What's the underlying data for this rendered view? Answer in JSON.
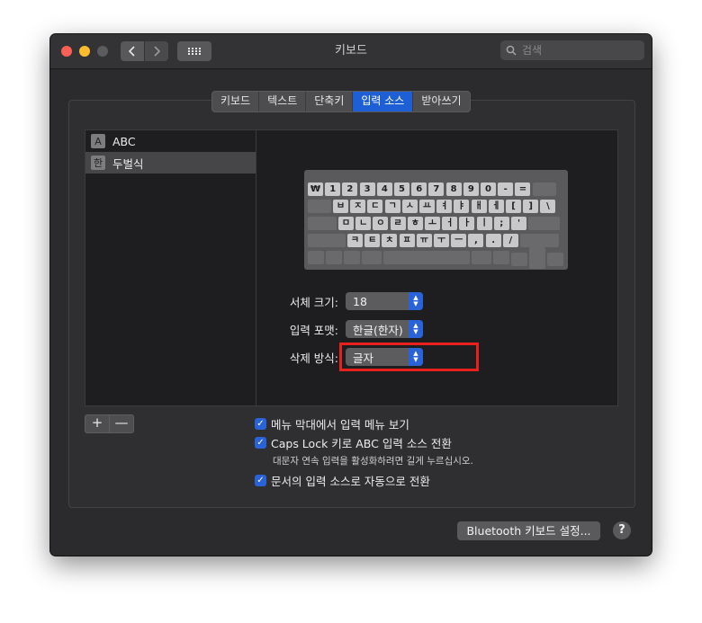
{
  "window": {
    "title": "키보드"
  },
  "search": {
    "placeholder": "검색"
  },
  "tabs": [
    {
      "label": "키보드"
    },
    {
      "label": "텍스트"
    },
    {
      "label": "단축키"
    },
    {
      "label": "입력 소스"
    },
    {
      "label": "받아쓰기"
    }
  ],
  "active_tab": "입력 소스",
  "sources": [
    {
      "icon": "A",
      "label": "ABC"
    },
    {
      "icon": "한",
      "label": "두벌식"
    }
  ],
  "keyboard": {
    "row1": [
      "₩",
      "1",
      "2",
      "3",
      "4",
      "5",
      "6",
      "7",
      "8",
      "9",
      "0",
      "-",
      "="
    ],
    "row2": [
      "ㅂ",
      "ㅈ",
      "ㄷ",
      "ㄱ",
      "ㅅ",
      "ㅛ",
      "ㅕ",
      "ㅑ",
      "ㅐ",
      "ㅔ",
      "[",
      "]",
      "\\"
    ],
    "row3": [
      "ㅁ",
      "ㄴ",
      "ㅇ",
      "ㄹ",
      "ㅎ",
      "ㅗ",
      "ㅓ",
      "ㅏ",
      "ㅣ",
      ";",
      "'"
    ],
    "row4": [
      "ㅋ",
      "ㅌ",
      "ㅊ",
      "ㅍ",
      "ㅠ",
      "ㅜ",
      "ㅡ",
      ",",
      ".",
      "/"
    ]
  },
  "form": {
    "font_size": {
      "label": "서체 크기:",
      "value": "18"
    },
    "input_format": {
      "label": "입력 포맷:",
      "value": "한글(한자)"
    },
    "delete_mode": {
      "label": "삭제 방식:",
      "value": "글자"
    }
  },
  "controls": {
    "add": "+",
    "remove": "—"
  },
  "checks": [
    {
      "label": "메뉴 막대에서 입력 메뉴 보기",
      "checked": true
    },
    {
      "label": "Caps Lock 키로 ABC 입력 소스 전환",
      "checked": true
    },
    {
      "label": "문서의 입력 소스로 자동으로 전환",
      "checked": true
    }
  ],
  "caps_note": "대문자 연속 입력을 활성화하려면 길게 누르십시오.",
  "bt_button": "Bluetooth 키보드 설정...",
  "help": "?"
}
